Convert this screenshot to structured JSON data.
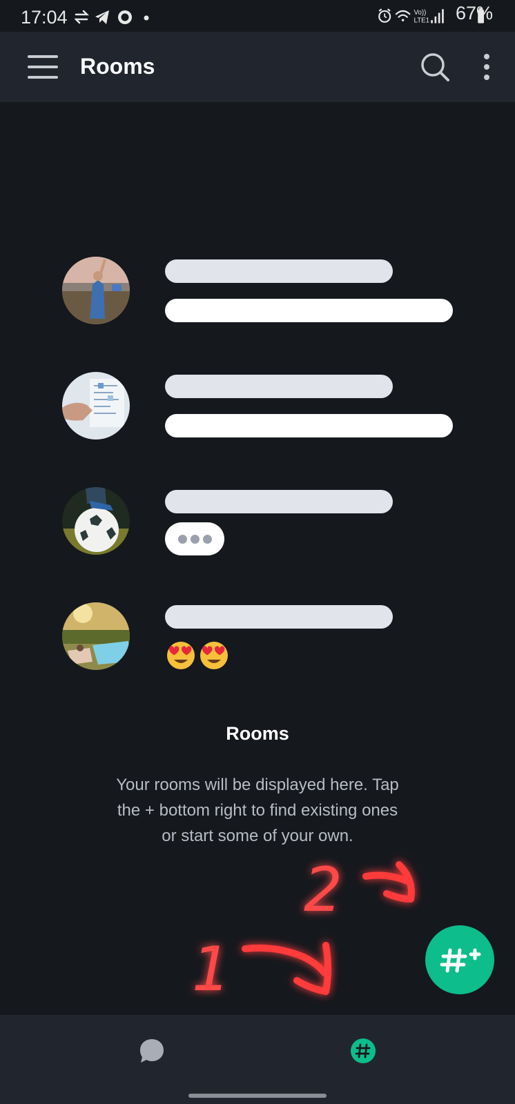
{
  "status_bar": {
    "time": "17:04",
    "battery": "67%",
    "icons_left": [
      "data-transfer-icon",
      "telegram-icon",
      "signal-icon",
      "dot-icon"
    ],
    "icons_right": [
      "alarm-icon",
      "wifi-icon",
      "volte-icon",
      "cell-signal-icon",
      "battery-icon"
    ]
  },
  "app_bar": {
    "title": "Rooms",
    "icons": [
      "menu-icon",
      "search-icon",
      "more-vert-icon"
    ]
  },
  "empty_state": {
    "title": "Rooms",
    "description": "Your rooms will be displayed here. Tap the + bottom right to find existing ones or start some of your own.",
    "emoji": "😍😍",
    "avatars": [
      "avatar-people-field",
      "avatar-whiteboard",
      "avatar-football",
      "avatar-pool"
    ]
  },
  "annotations": {
    "label_1": "1",
    "label_2": "2"
  },
  "fab": {
    "icon": "room-plus-icon",
    "label": "#+"
  },
  "bottom_nav": {
    "items": [
      {
        "icon": "chat-bubble-icon",
        "active": false
      },
      {
        "icon": "hash-icon",
        "active": true
      }
    ]
  },
  "colors": {
    "background": "#15181d",
    "bar": "#21262e",
    "accent": "#0dbd8b",
    "annotation": "#ff3b3b"
  }
}
